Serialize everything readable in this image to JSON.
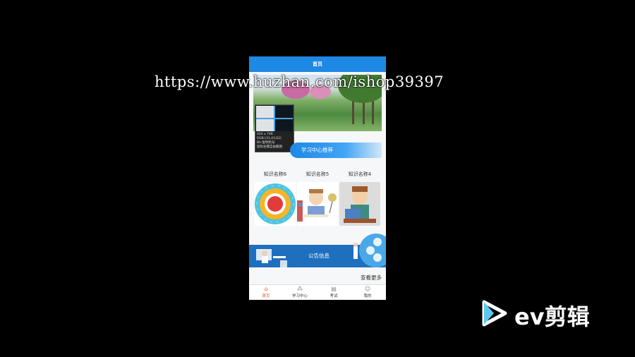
{
  "app": {
    "title": "首页"
  },
  "tooltip": {
    "size": "424 x 746",
    "rgb": "RGB:(31,43,62)",
    "hint_copy": "Bh:复制色号",
    "hint_capture": "鼠标右键自由截图"
  },
  "recommend": {
    "title": "学习中心推荐"
  },
  "knowledge_items": [
    {
      "label": "知识名称6"
    },
    {
      "label": "知识名称5"
    },
    {
      "label": "知识名称4"
    }
  ],
  "notice": {
    "title": "公告信息",
    "more": "查看更多"
  },
  "tabs": [
    {
      "label": "首页",
      "icon": "home-icon",
      "active": true
    },
    {
      "label": "学习中心",
      "icon": "grid-icon",
      "active": false
    },
    {
      "label": "考试",
      "icon": "exam-icon",
      "active": false
    },
    {
      "label": "我的",
      "icon": "user-icon",
      "active": false
    }
  ],
  "watermark": "https://www.huzhan.com/ishop39397",
  "brand": {
    "name": "ev剪辑"
  },
  "colors": {
    "primary": "#1e88e5",
    "active_tab": "#e05a2a",
    "background": "#000000"
  }
}
